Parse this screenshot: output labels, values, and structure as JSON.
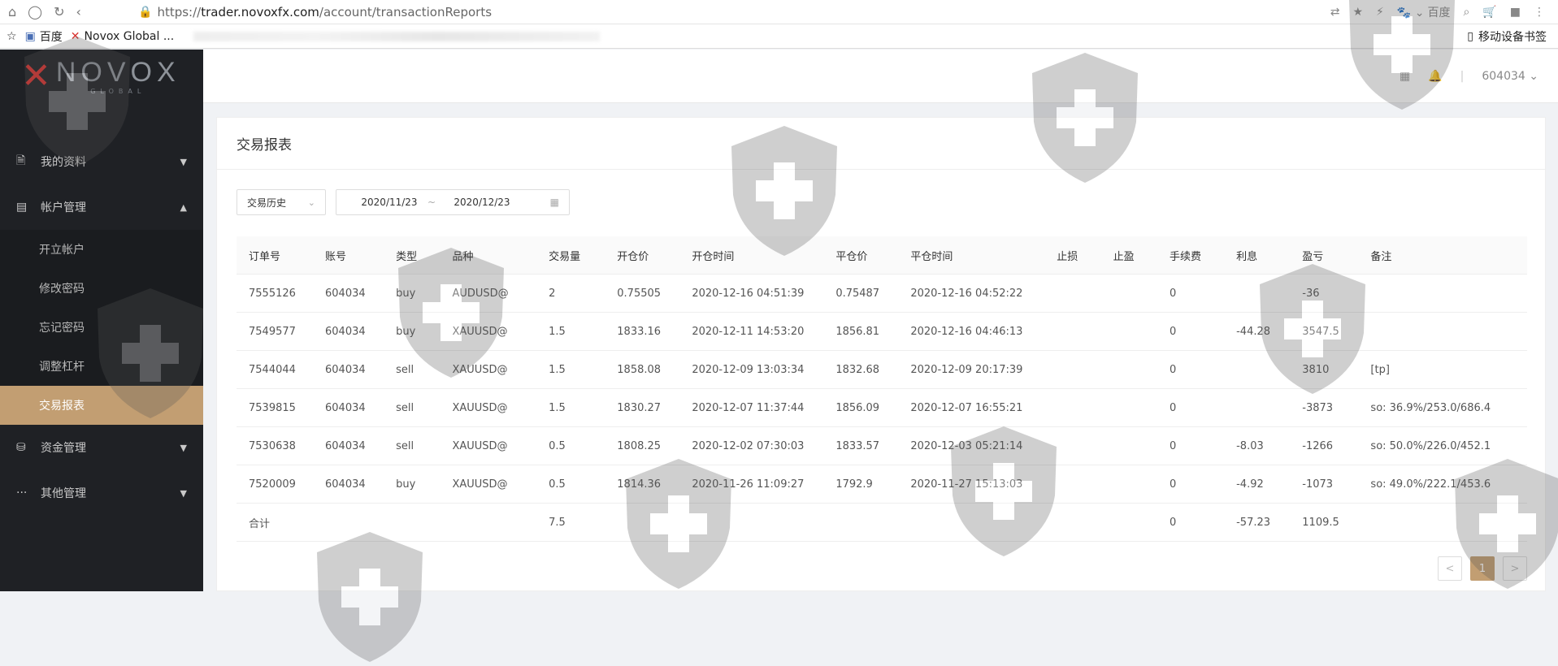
{
  "browser": {
    "url_scheme": "https://",
    "url_host": "trader.novoxfx.com",
    "url_path": "/account/transactionReports",
    "search_engine": "百度"
  },
  "bookmarks": {
    "items": [
      {
        "label": "百度"
      },
      {
        "label": "Novox Global ..."
      }
    ],
    "mobile_bookmarks": "移动设备书签"
  },
  "sidebar": {
    "logo_word": "NOVOX",
    "logo_sub": "GLOBAL",
    "menu": [
      {
        "label": "我的资料",
        "icon": "document-icon",
        "expanded": false
      },
      {
        "label": "帐户管理",
        "icon": "card-icon",
        "expanded": true
      },
      {
        "label": "资金管理",
        "icon": "database-icon",
        "expanded": false
      },
      {
        "label": "其他管理",
        "icon": "more-icon",
        "expanded": false
      }
    ],
    "account_submenu": [
      {
        "label": "开立帐户"
      },
      {
        "label": "修改密码"
      },
      {
        "label": "忘记密码"
      },
      {
        "label": "调整杠杆"
      },
      {
        "label": "交易报表",
        "active": true
      }
    ]
  },
  "topbar": {
    "user": "604034"
  },
  "page": {
    "title": "交易报表",
    "report_type": "交易历史",
    "date_from": "2020/11/23",
    "date_separator": "~",
    "date_to": "2020/12/23"
  },
  "table": {
    "headers": [
      "订单号",
      "账号",
      "类型",
      "品种",
      "交易量",
      "开仓价",
      "开仓时间",
      "平仓价",
      "平仓时间",
      "止损",
      "止盈",
      "手续费",
      "利息",
      "盈亏",
      "备注"
    ],
    "rows": [
      [
        "7555126",
        "604034",
        "buy",
        "AUDUSD@",
        "2",
        "0.75505",
        "2020-12-16 04:51:39",
        "0.75487",
        "2020-12-16 04:52:22",
        "",
        "",
        "0",
        "",
        "-36",
        ""
      ],
      [
        "7549577",
        "604034",
        "buy",
        "XAUUSD@",
        "1.5",
        "1833.16",
        "2020-12-11 14:53:20",
        "1856.81",
        "2020-12-16 04:46:13",
        "",
        "",
        "0",
        "-44.28",
        "3547.5",
        ""
      ],
      [
        "7544044",
        "604034",
        "sell",
        "XAUUSD@",
        "1.5",
        "1858.08",
        "2020-12-09 13:03:34",
        "1832.68",
        "2020-12-09 20:17:39",
        "",
        "",
        "0",
        "",
        "3810",
        "[tp]"
      ],
      [
        "7539815",
        "604034",
        "sell",
        "XAUUSD@",
        "1.5",
        "1830.27",
        "2020-12-07 11:37:44",
        "1856.09",
        "2020-12-07 16:55:21",
        "",
        "",
        "0",
        "",
        "-3873",
        "so: 36.9%/253.0/686.4"
      ],
      [
        "7530638",
        "604034",
        "sell",
        "XAUUSD@",
        "0.5",
        "1808.25",
        "2020-12-02 07:30:03",
        "1833.57",
        "2020-12-03 05:21:14",
        "",
        "",
        "0",
        "-8.03",
        "-1266",
        "so: 50.0%/226.0/452.1"
      ],
      [
        "7520009",
        "604034",
        "buy",
        "XAUUSD@",
        "0.5",
        "1814.36",
        "2020-11-26 11:09:27",
        "1792.9",
        "2020-11-27 15:13:03",
        "",
        "",
        "0",
        "-4.92",
        "-1073",
        "so: 49.0%/222.1/453.6"
      ]
    ],
    "total_row": [
      "合计",
      "",
      "",
      "",
      "7.5",
      "",
      "",
      "",
      "",
      "",
      "",
      "0",
      "-57.23",
      "1109.5",
      ""
    ]
  },
  "pagination": {
    "prev": "<",
    "current": "1",
    "next": ">"
  },
  "colors": {
    "sidebar_bg": "#1f2125",
    "accent": "#c29e72",
    "logo_red": "#d8322f"
  }
}
